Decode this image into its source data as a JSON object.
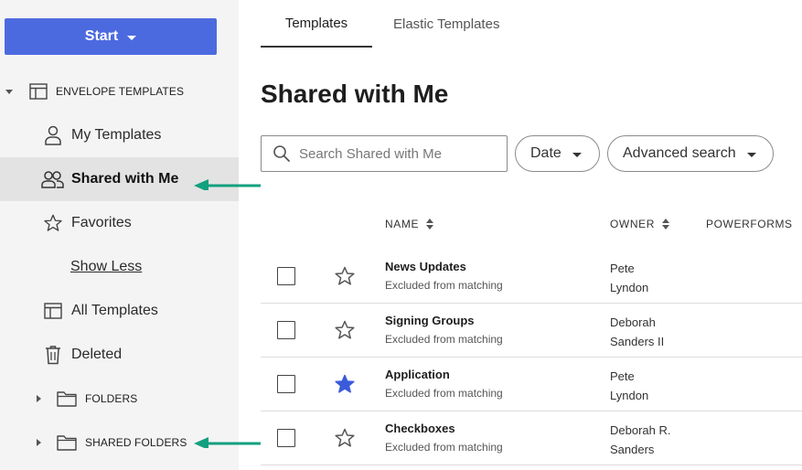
{
  "sidebar": {
    "start_label": "Start",
    "envelope_templates_label": "ENVELOPE TEMPLATES",
    "items": [
      {
        "label": "My Templates",
        "icon": "person-icon"
      },
      {
        "label": "Shared with Me",
        "icon": "people-icon",
        "active": true
      },
      {
        "label": "Favorites",
        "icon": "star-outline-icon"
      },
      {
        "label": "Show Less"
      },
      {
        "label": "All Templates",
        "icon": "template-grid-icon"
      },
      {
        "label": "Deleted",
        "icon": "trash-icon"
      }
    ],
    "folders_label": "FOLDERS",
    "shared_folders_label": "SHARED FOLDERS"
  },
  "tabs": [
    {
      "label": "Templates",
      "active": true
    },
    {
      "label": "Elastic Templates"
    }
  ],
  "main": {
    "title": "Shared with Me",
    "search_placeholder": "Search Shared with Me",
    "date_filter_label": "Date",
    "advanced_search_label": "Advanced search",
    "columns": {
      "name": "NAME",
      "owner": "OWNER",
      "powerforms": "POWERFORMS"
    },
    "rows": [
      {
        "name": "News Updates",
        "sub": "Excluded from matching",
        "owner_line1": "Pete",
        "owner_line2": "Lyndon",
        "favorite": false
      },
      {
        "name": "Signing Groups",
        "sub": "Excluded from matching",
        "owner_line1": "Deborah",
        "owner_line2": "Sanders II",
        "favorite": false
      },
      {
        "name": "Application",
        "sub": "Excluded from matching",
        "owner_line1": "Pete",
        "owner_line2": "Lyndon",
        "favorite": true
      },
      {
        "name": "Checkboxes",
        "sub": "Excluded from matching",
        "owner_line1": "Deborah R.",
        "owner_line2": "Sanders",
        "favorite": false
      }
    ]
  },
  "colors": {
    "accent": "#4c6ae0",
    "annotation_arrow": "#13a07e",
    "favorite_star": "#3b5bdb"
  }
}
